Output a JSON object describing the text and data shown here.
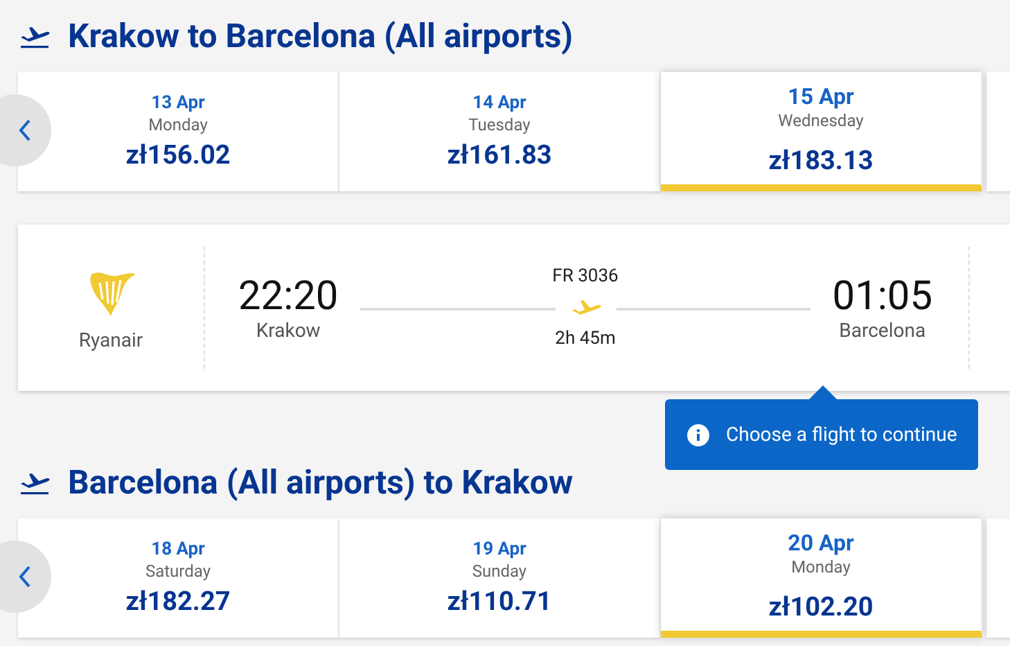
{
  "outbound": {
    "title": "Krakow to Barcelona (All airports)",
    "dates": [
      {
        "date": "13 Apr",
        "day": "Monday",
        "price": "zł156.02",
        "selected": false
      },
      {
        "date": "14 Apr",
        "day": "Tuesday",
        "price": "zł161.83",
        "selected": false
      },
      {
        "date": "15 Apr",
        "day": "Wednesday",
        "price": "zł183.13",
        "selected": true
      }
    ]
  },
  "flight": {
    "airline": "Ryanair",
    "depart_time": "22:20",
    "depart_city": "Krakow",
    "number": "FR 3036",
    "duration": "2h 45m",
    "arrive_time": "01:05",
    "arrive_city": "Barcelona"
  },
  "tooltip": {
    "text": "Choose a flight to continue"
  },
  "return": {
    "title": "Barcelona (All airports) to Krakow",
    "dates": [
      {
        "date": "18 Apr",
        "day": "Saturday",
        "price": "zł182.27",
        "selected": false
      },
      {
        "date": "19 Apr",
        "day": "Sunday",
        "price": "zł110.71",
        "selected": false
      },
      {
        "date": "20 Apr",
        "day": "Monday",
        "price": "zł102.20",
        "selected": true
      }
    ]
  }
}
